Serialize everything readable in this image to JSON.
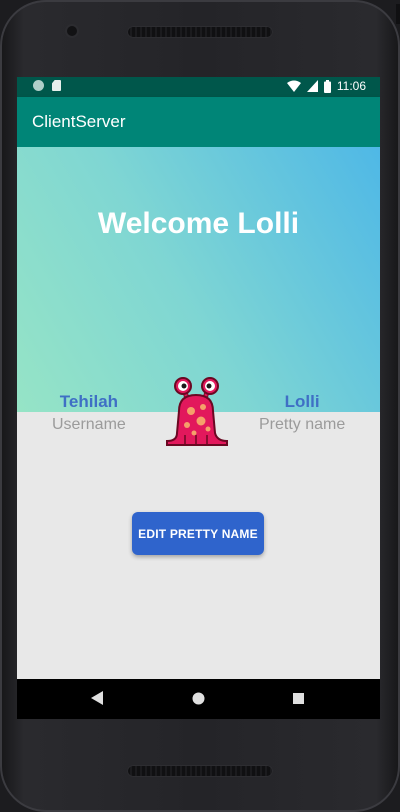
{
  "status_bar": {
    "time": "11:06",
    "icons": [
      "notification-dot-icon",
      "sd-card-icon",
      "wifi-icon",
      "signal-icon",
      "battery-icon"
    ]
  },
  "app_bar": {
    "title": "ClientServer",
    "color": "#008577"
  },
  "hero": {
    "welcome_text": "Welcome Lolli",
    "gradient": [
      "#96e4c6",
      "#4fb8e6"
    ]
  },
  "user": {
    "username_value": "Tehilah",
    "username_caption": "Username",
    "pretty_name_value": "Lolli",
    "pretty_name_caption": "Pretty name"
  },
  "avatar": {
    "icon": "pink-monster-icon"
  },
  "actions": {
    "edit_button_label": "EDIT PRETTY NAME",
    "button_color": "#2f64cc"
  },
  "nav_bar": {
    "buttons": [
      "back-icon",
      "home-icon",
      "recents-icon"
    ]
  }
}
